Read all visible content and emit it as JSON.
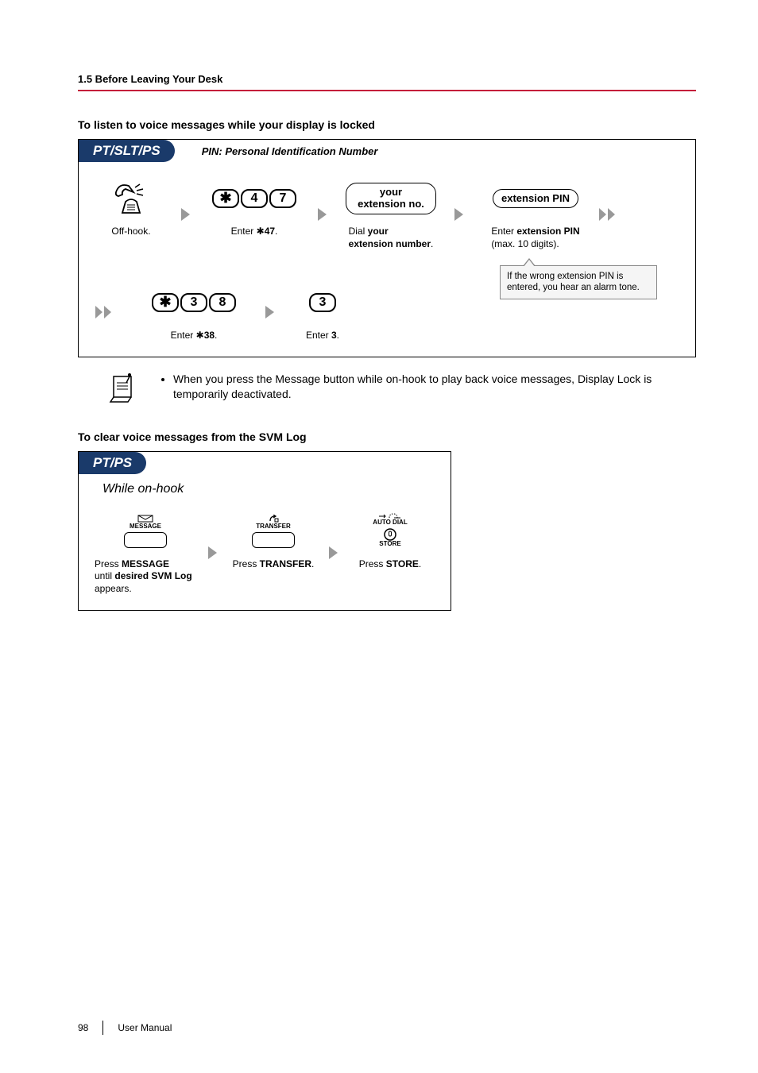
{
  "header": {
    "section": "1.5 Before Leaving Your Desk"
  },
  "proc1": {
    "heading": "To listen to voice messages while your display is locked",
    "badge": "PT/SLT/PS",
    "pin_note": "PIN: Personal Identification Number",
    "steps": {
      "offhook": "Off-hook.",
      "enter47_pre": "Enter ",
      "enter47_code": "47",
      "enter47_post": ".",
      "ext_pill_l1": "your",
      "ext_pill_l2": "extension no.",
      "dial_pre": "Dial ",
      "dial_bold": "your",
      "dial_l2": "extension number",
      "pin_pill": "extension PIN",
      "pin_pre": "Enter ",
      "pin_bold": "extension PIN",
      "pin_l2": "(max. 10 digits).",
      "tip_l1": "If the wrong extension PIN is",
      "tip_l2": "entered, you hear an alarm tone.",
      "enter38_pre": "Enter ",
      "enter38_code": "38",
      "enter38_post": ".",
      "enter3_pre": "Enter ",
      "enter3_code": "3",
      "enter3_post": "."
    },
    "keys": {
      "star": "✱",
      "k4": "4",
      "k7": "7",
      "k3a": "3",
      "k8": "8",
      "k3b": "3"
    }
  },
  "note1": {
    "text": "When you press the Message button while on-hook to play back voice messages, Display Lock is temporarily deactivated."
  },
  "proc2": {
    "heading": "To clear voice messages from the SVM Log",
    "badge": "PT/PS",
    "while": "While on-hook",
    "steps": {
      "msg_label": "MESSAGE",
      "msg_cap_pre": "Press ",
      "msg_cap_b1": "MESSAGE",
      "msg_cap_mid": "until ",
      "msg_cap_b2": "desired SVM Log",
      "msg_cap_post": "appears.",
      "transfer_label": "TRANSFER",
      "transfer_cap_pre": "Press ",
      "transfer_cap_b": "TRANSFER",
      "autodial_l1": "AUTO DIAL",
      "autodial_l2": "STORE",
      "store_cap_pre": "Press ",
      "store_cap_b": "STORE"
    }
  },
  "footer": {
    "page": "98",
    "label": "User Manual"
  }
}
